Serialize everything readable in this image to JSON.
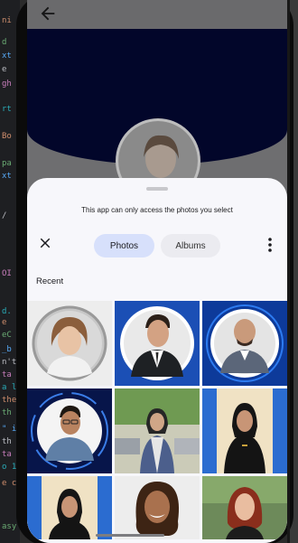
{
  "editor": {
    "visible_chars": [
      "ni",
      "d",
      "xt",
      "e",
      "gh",
      "rt",
      "Bo",
      "pa",
      "xt",
      "/",
      "OI",
      "d.",
      "e",
      "eC",
      "_b",
      "n't",
      "ta",
      "a l",
      "the",
      "th",
      "\" i",
      "th",
      "ta",
      "o 1",
      "e c",
      "asy"
    ]
  },
  "app": {
    "back_icon": "arrow-left-icon",
    "header_color": "#02062a"
  },
  "sheet": {
    "notice": "This app can only access the photos you select",
    "close_icon": "close-icon",
    "tabs": [
      {
        "label": "Photos",
        "selected": true
      },
      {
        "label": "Albums",
        "selected": false
      }
    ],
    "more_icon": "more-vert-icon",
    "section_title": "Recent",
    "accent": "#d7e0fb"
  },
  "photos": [
    {
      "desc": "woman-portrait-grey-circle"
    },
    {
      "desc": "man-suit-blue-circle"
    },
    {
      "desc": "bald-man-blue-circle"
    },
    {
      "desc": "man-glasses-dark-circle"
    },
    {
      "desc": "woman-hijab-street"
    },
    {
      "desc": "woman-hijab-black-abaya"
    },
    {
      "desc": "woman-hijab-blue-pillar"
    },
    {
      "desc": "woman-curly-hair"
    },
    {
      "desc": "woman-red-hair"
    }
  ]
}
